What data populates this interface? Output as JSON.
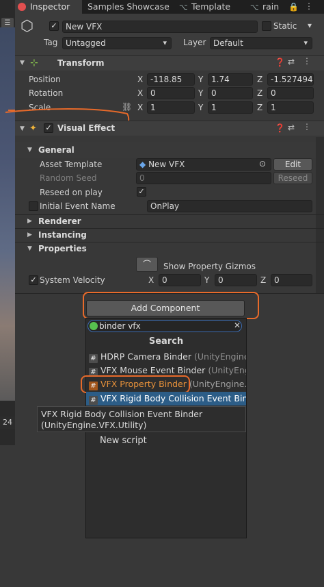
{
  "tabs": [
    {
      "label": "Inspector",
      "active": true
    },
    {
      "label": "Samples Showcase"
    },
    {
      "label": "Template"
    },
    {
      "label": "rain"
    }
  ],
  "left_strip_label": "24",
  "gameobject": {
    "active": true,
    "name": "New VFX",
    "static_label": "Static",
    "tag_label": "Tag",
    "tag_value": "Untagged",
    "layer_label": "Layer",
    "layer_value": "Default"
  },
  "transform": {
    "title": "Transform",
    "rows": [
      {
        "label": "Position",
        "x": "-118.85",
        "y": "1.74",
        "z": "-1.527494"
      },
      {
        "label": "Rotation",
        "x": "0",
        "y": "0",
        "z": "0"
      },
      {
        "label": "Scale",
        "x": "1",
        "y": "1",
        "z": "1"
      }
    ],
    "axis_x": "X",
    "axis_y": "Y",
    "axis_z": "Z"
  },
  "visual_effect": {
    "title": "Visual Effect",
    "enabled": true,
    "general_label": "General",
    "asset_template_label": "Asset Template",
    "asset_template_value": "New VFX",
    "edit_label": "Edit",
    "random_seed_label": "Random Seed",
    "random_seed_value": "0",
    "reseed_label": "Reseed",
    "reseed_on_play_label": "Reseed on play",
    "reseed_on_play": true,
    "initial_event_label": "Initial Event Name",
    "initial_event_value": "OnPlay",
    "renderer_label": "Renderer",
    "instancing_label": "Instancing",
    "properties_label": "Properties",
    "show_gizmos_label": "Show Property Gizmos",
    "system_velocity_label": "System Velocity",
    "system_velocity": {
      "x": "0",
      "y": "0",
      "z": "0"
    }
  },
  "add_component": {
    "button_label": "Add Component",
    "search_query": "binder vfx",
    "search_title": "Search",
    "items": [
      {
        "name": "HDRP Camera Binder",
        "ns": "(UnityEngine"
      },
      {
        "name": "VFX Mouse Event Binder",
        "ns": "(UnityEngi"
      },
      {
        "name": "VFX Property Binder",
        "ns": "(UnityEngine."
      },
      {
        "name": "VFX Rigid Body Collision Event Bin",
        "ns": ""
      }
    ],
    "tooltip_line1": "VFX Rigid Body Collision Event Binder",
    "tooltip_line2": "(UnityEngine.VFX.Utility)",
    "new_script_label": "New script"
  },
  "colors": {
    "accent_orange": "#e86a2a",
    "selection_blue": "#2c5d87"
  }
}
